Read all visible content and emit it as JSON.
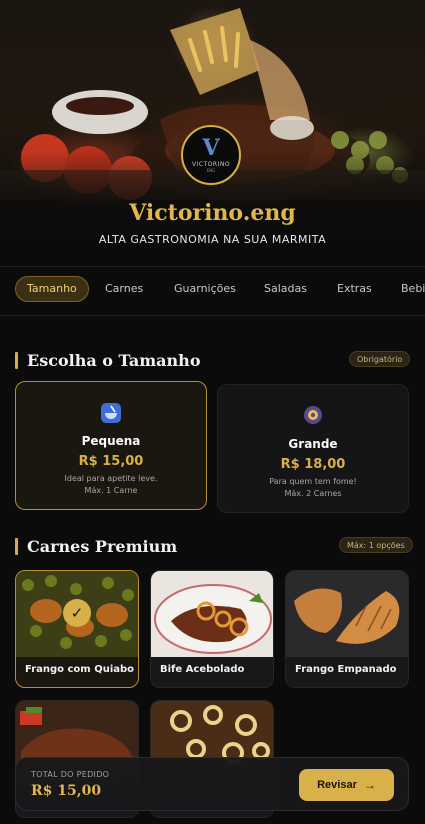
{
  "hero": {
    "brand": "Victorino.eng",
    "tagline": "ALTA GASTRONOMIA NA SUA MARMITA",
    "logo_mark": "V",
    "logo_text": "VICTORINO",
    "logo_sub": "ENG"
  },
  "tabs": [
    {
      "label": "Tamanho",
      "active": true
    },
    {
      "label": "Carnes",
      "active": false
    },
    {
      "label": "Guarnições",
      "active": false
    },
    {
      "label": "Saladas",
      "active": false
    },
    {
      "label": "Extras",
      "active": false
    },
    {
      "label": "Bebi",
      "active": false
    }
  ],
  "size_section": {
    "title": "Escolha o Tamanho",
    "badge": "Obrigatório",
    "options": [
      {
        "name": "Pequena",
        "price": "R$ 15,00",
        "desc": "Ideal para apetite leve.",
        "max": "Máx. 1 Carne",
        "selected": true,
        "icon": "bowl-icon"
      },
      {
        "name": "Grande",
        "price": "R$ 18,00",
        "desc": "Para quem tem fome!",
        "max": "Máx. 2 Carnes",
        "selected": false,
        "icon": "plate-icon"
      }
    ]
  },
  "meat_section": {
    "title": "Carnes Premium",
    "badge": "Máx: 1 opções",
    "items": [
      {
        "name": "Frango com Quiabo",
        "selected": true
      },
      {
        "name": "Bife Acebolado",
        "selected": false
      },
      {
        "name": "Frango Empanado",
        "selected": false
      },
      {
        "name": "",
        "selected": false
      },
      {
        "name": "",
        "selected": false
      }
    ]
  },
  "footer": {
    "total_label": "TOTAL DO PEDIDO",
    "total_value": "R$ 15,00",
    "review_label": "Revisar",
    "review_icon": "arrow-right-icon"
  },
  "colors": {
    "accent": "#d9b14a",
    "background": "#0b0b0c",
    "card": "#151517"
  }
}
